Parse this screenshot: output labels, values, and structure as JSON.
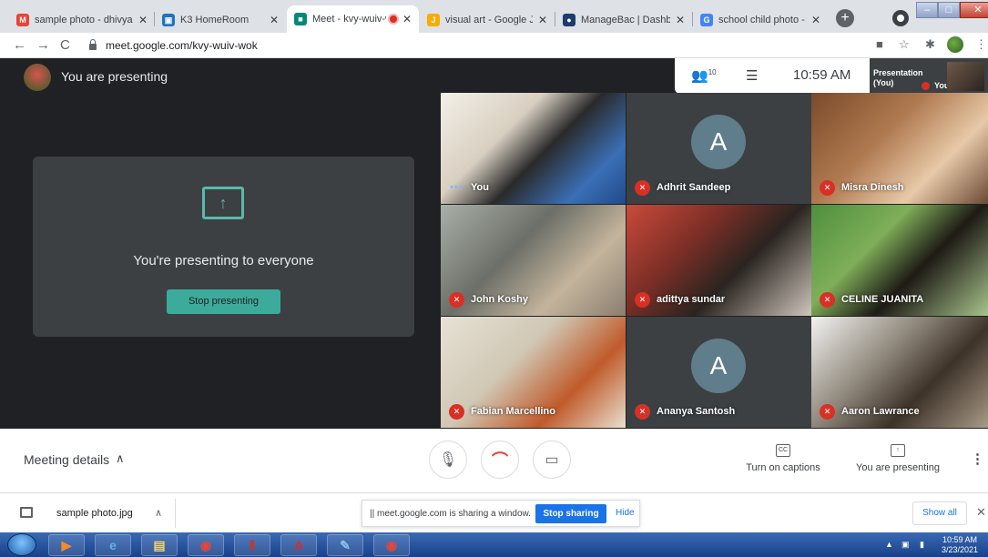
{
  "browser": {
    "tabs": [
      {
        "title": "sample photo - dhivya.",
        "icon": "gmail-icon",
        "color": "#ea4335",
        "glyph": "M"
      },
      {
        "title": "K3 HomeRoom",
        "icon": "classroom-icon",
        "color": "#1e73be",
        "glyph": "▣"
      },
      {
        "title": "Meet - kvy-wuiv-w",
        "icon": "meet-icon",
        "color": "#00897b",
        "glyph": "■"
      },
      {
        "title": "visual art - Google Jam",
        "icon": "jamboard-icon",
        "color": "#f9ab00",
        "glyph": "J"
      },
      {
        "title": "ManageBac | Dashboar",
        "icon": "managebac-icon",
        "color": "#1a3d6d",
        "glyph": "●"
      },
      {
        "title": "school child photo - Go",
        "icon": "google-icon",
        "color": "#4285f4",
        "glyph": "G"
      }
    ],
    "url": "meet.google.com/kvy-wuiv-wok"
  },
  "meet": {
    "presenting_title": "You are presenting",
    "panel_message": "You're presenting to everyone",
    "stop_presenting": "Stop presenting",
    "people_count": "10",
    "time": "10:59 AM",
    "self_view_label_1": "Presentation",
    "self_view_label_2": "(You)",
    "self_view_you": "You",
    "tiles": [
      {
        "name": "You",
        "letter": "",
        "muted": false,
        "bg": "linear-gradient(135deg,#f3f0e8 0%,#d8cfc0 35%,#2a2a2a 55%,#3b6fb6 80%,#1f4a8a 100%)"
      },
      {
        "name": "Adhrit Sandeep",
        "letter": "A",
        "muted": true,
        "bg": "#3c4043"
      },
      {
        "name": "Misra Dinesh",
        "letter": "",
        "muted": true,
        "bg": "linear-gradient(135deg,#7a4a2a 0%,#b07a50 40%,#e7c9a8 70%,#6b4a34 100%)"
      },
      {
        "name": "John Koshy",
        "letter": "",
        "muted": true,
        "bg": "linear-gradient(135deg,#a9b0a8 0%,#6c6f68 40%,#c4b49c 70%,#8a7e6e 100%)"
      },
      {
        "name": "adittya sundar",
        "letter": "",
        "muted": true,
        "bg": "linear-gradient(135deg,#c94a3a 0%,#7a2e26 35%,#2a2420 60%,#cfc6bc 100%)"
      },
      {
        "name": "CELINE JUANITA",
        "letter": "",
        "muted": true,
        "bg": "linear-gradient(135deg,#4e8f3e 0%,#7fae58 35%,#1e1a16 60%,#a7c48a 100%)"
      },
      {
        "name": "Fabian Marcellino",
        "letter": "",
        "muted": true,
        "bg": "linear-gradient(135deg,#e7e2d6 0%,#d0c7b4 40%,#c05a2a 70%,#e8e0d0 100%)"
      },
      {
        "name": "Ananya Santosh",
        "letter": "A",
        "muted": true,
        "bg": "#3c4043"
      },
      {
        "name": "Aaron Lawrance",
        "letter": "",
        "muted": true,
        "bg": "linear-gradient(135deg,#f2f2f0 0%,#8c8478 40%,#3d3228 65%,#a99a88 100%)"
      }
    ]
  },
  "controls": {
    "meeting_details": "Meeting details",
    "captions": "Turn on captions",
    "captions_icon": "CC",
    "you_presenting": "You are presenting"
  },
  "downloads": {
    "file": "sample photo.jpg",
    "share_message": "meet.google.com is sharing a window.",
    "stop_sharing": "Stop sharing",
    "hide": "Hide",
    "show_all": "Show all"
  },
  "taskbar": {
    "time": "10:59 AM",
    "date": "3/23/2021",
    "items": [
      {
        "icon": "media-player-icon",
        "glyph": "▶",
        "color": "#f28b2b"
      },
      {
        "icon": "ie-icon",
        "glyph": "e",
        "color": "#5ab4f0"
      },
      {
        "icon": "file-explorer-icon",
        "glyph": "▤",
        "color": "#f2d36b"
      },
      {
        "icon": "chrome-icon",
        "glyph": "◉",
        "color": "#e8453c"
      },
      {
        "icon": "downloader-icon",
        "glyph": "⬇",
        "color": "#c0392b"
      },
      {
        "icon": "acrobat-icon",
        "glyph": "A",
        "color": "#e02b20"
      },
      {
        "icon": "paint-icon",
        "glyph": "✎",
        "color": "#88c0e8"
      },
      {
        "icon": "chrome-icon",
        "glyph": "◉",
        "color": "#e8453c"
      }
    ]
  }
}
